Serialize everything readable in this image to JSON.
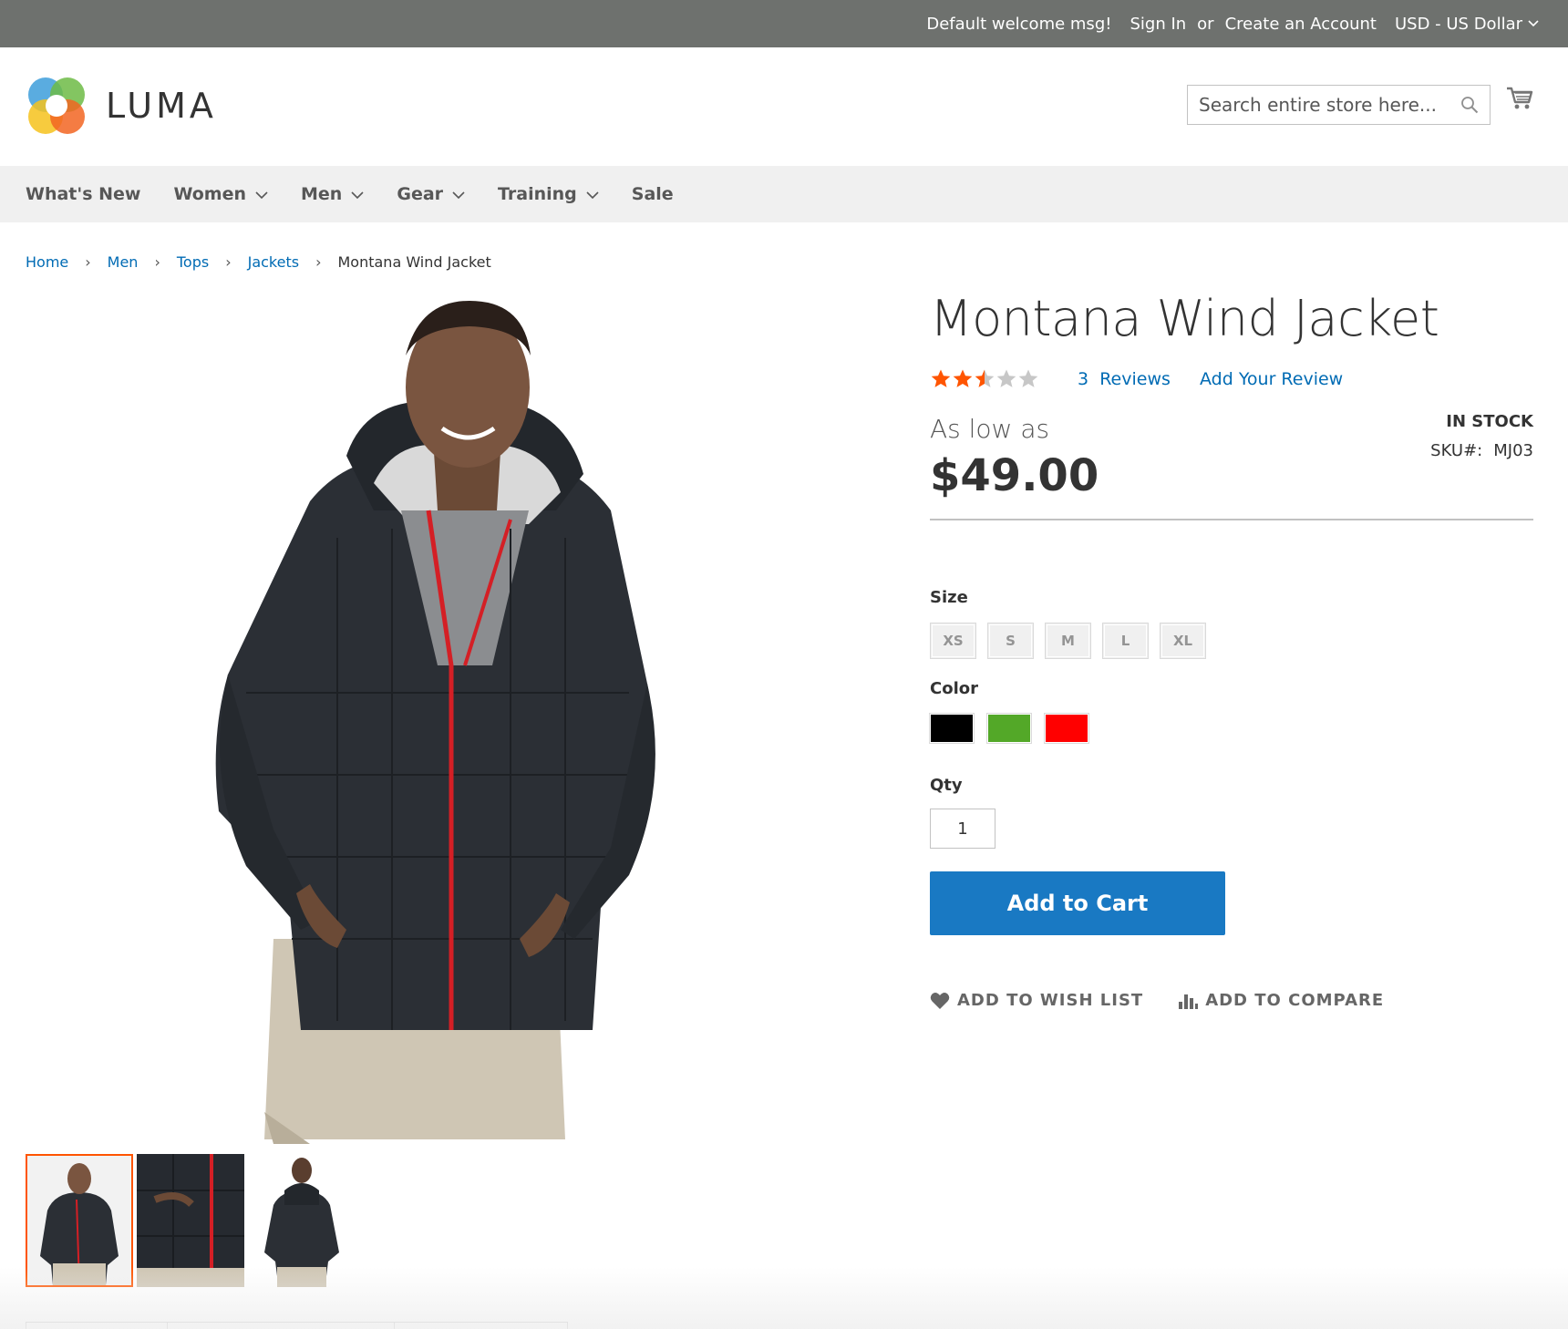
{
  "topbar": {
    "welcome": "Default welcome msg!",
    "sign_in": "Sign In",
    "or": "or",
    "create_account": "Create an Account",
    "currency": "USD - US Dollar"
  },
  "header": {
    "logo_text": "LUMA",
    "search_placeholder": "Search entire store here..."
  },
  "nav": {
    "items": [
      {
        "label": "What's New",
        "has_dropdown": false
      },
      {
        "label": "Women",
        "has_dropdown": true
      },
      {
        "label": "Men",
        "has_dropdown": true
      },
      {
        "label": "Gear",
        "has_dropdown": true
      },
      {
        "label": "Training",
        "has_dropdown": true
      },
      {
        "label": "Sale",
        "has_dropdown": false
      }
    ]
  },
  "breadcrumb": {
    "items": [
      "Home",
      "Men",
      "Tops",
      "Jackets"
    ],
    "current": "Montana Wind Jacket"
  },
  "product": {
    "title": "Montana Wind Jacket",
    "rating_stars": 2.5,
    "rating_max": 5,
    "reviews_count": "3",
    "reviews_label": "Reviews",
    "add_review": "Add Your Review",
    "as_low_as": "As low as",
    "price": "$49.00",
    "stock": "IN STOCK",
    "sku_label": "SKU#:",
    "sku": "MJ03",
    "size_label": "Size",
    "sizes": [
      "XS",
      "S",
      "M",
      "L",
      "XL"
    ],
    "color_label": "Color",
    "colors": [
      "#000000",
      "#53a828",
      "#ff0000"
    ],
    "qty_label": "Qty",
    "qty": "1",
    "add_to_cart": "Add to Cart",
    "wish_list": "ADD TO WISH LIST",
    "compare": "ADD TO COMPARE"
  },
  "colors": {
    "accent_blue": "#1979c3",
    "link_blue": "#006bb4",
    "star_orange": "#ff5501",
    "topbar_bg": "#6e716e"
  }
}
